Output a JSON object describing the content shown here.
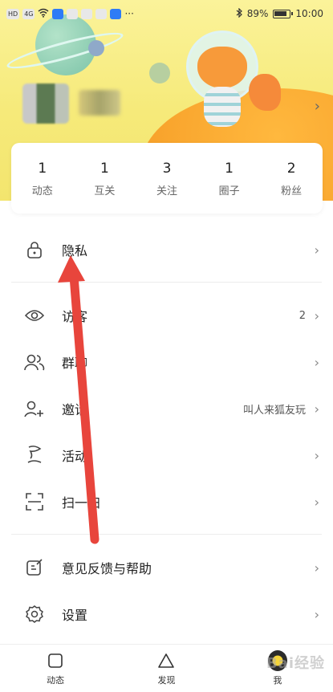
{
  "status_bar": {
    "left_chips": [
      "HD",
      "4G",
      "",
      "",
      "",
      "",
      ""
    ],
    "battery": "89%",
    "time": "10:00"
  },
  "stats": [
    {
      "count": "1",
      "label": "动态"
    },
    {
      "count": "1",
      "label": "互关"
    },
    {
      "count": "3",
      "label": "关注"
    },
    {
      "count": "1",
      "label": "圈子"
    },
    {
      "count": "2",
      "label": "粉丝"
    }
  ],
  "menu": {
    "privacy": {
      "label": "隐私",
      "icon": "lock-icon"
    },
    "visitors": {
      "label": "访客",
      "extra": "2",
      "icon": "eye-icon"
    },
    "group_chat": {
      "label": "群聊",
      "icon": "group-icon"
    },
    "invite": {
      "label": "邀请",
      "extra": "叫人来狐友玩",
      "icon": "add-person-icon"
    },
    "activity": {
      "label": "活动",
      "icon": "flag-icon"
    },
    "scan": {
      "label": "扫一扫",
      "icon": "scan-icon"
    },
    "feedback": {
      "label": "意见反馈与帮助",
      "icon": "edit-icon"
    },
    "settings": {
      "label": "设置",
      "icon": "gear-icon"
    }
  },
  "bottom_nav": [
    {
      "label": "动态",
      "icon": "square-icon"
    },
    {
      "label": "发现",
      "icon": "triangle-icon"
    },
    {
      "label": "我",
      "icon": "me-icon"
    }
  ],
  "watermark": "Bai经验",
  "colors": {
    "header_yellow": "#f6ea7a",
    "annotation_red": "#e8453c",
    "planet_orange": "#f59a24"
  }
}
